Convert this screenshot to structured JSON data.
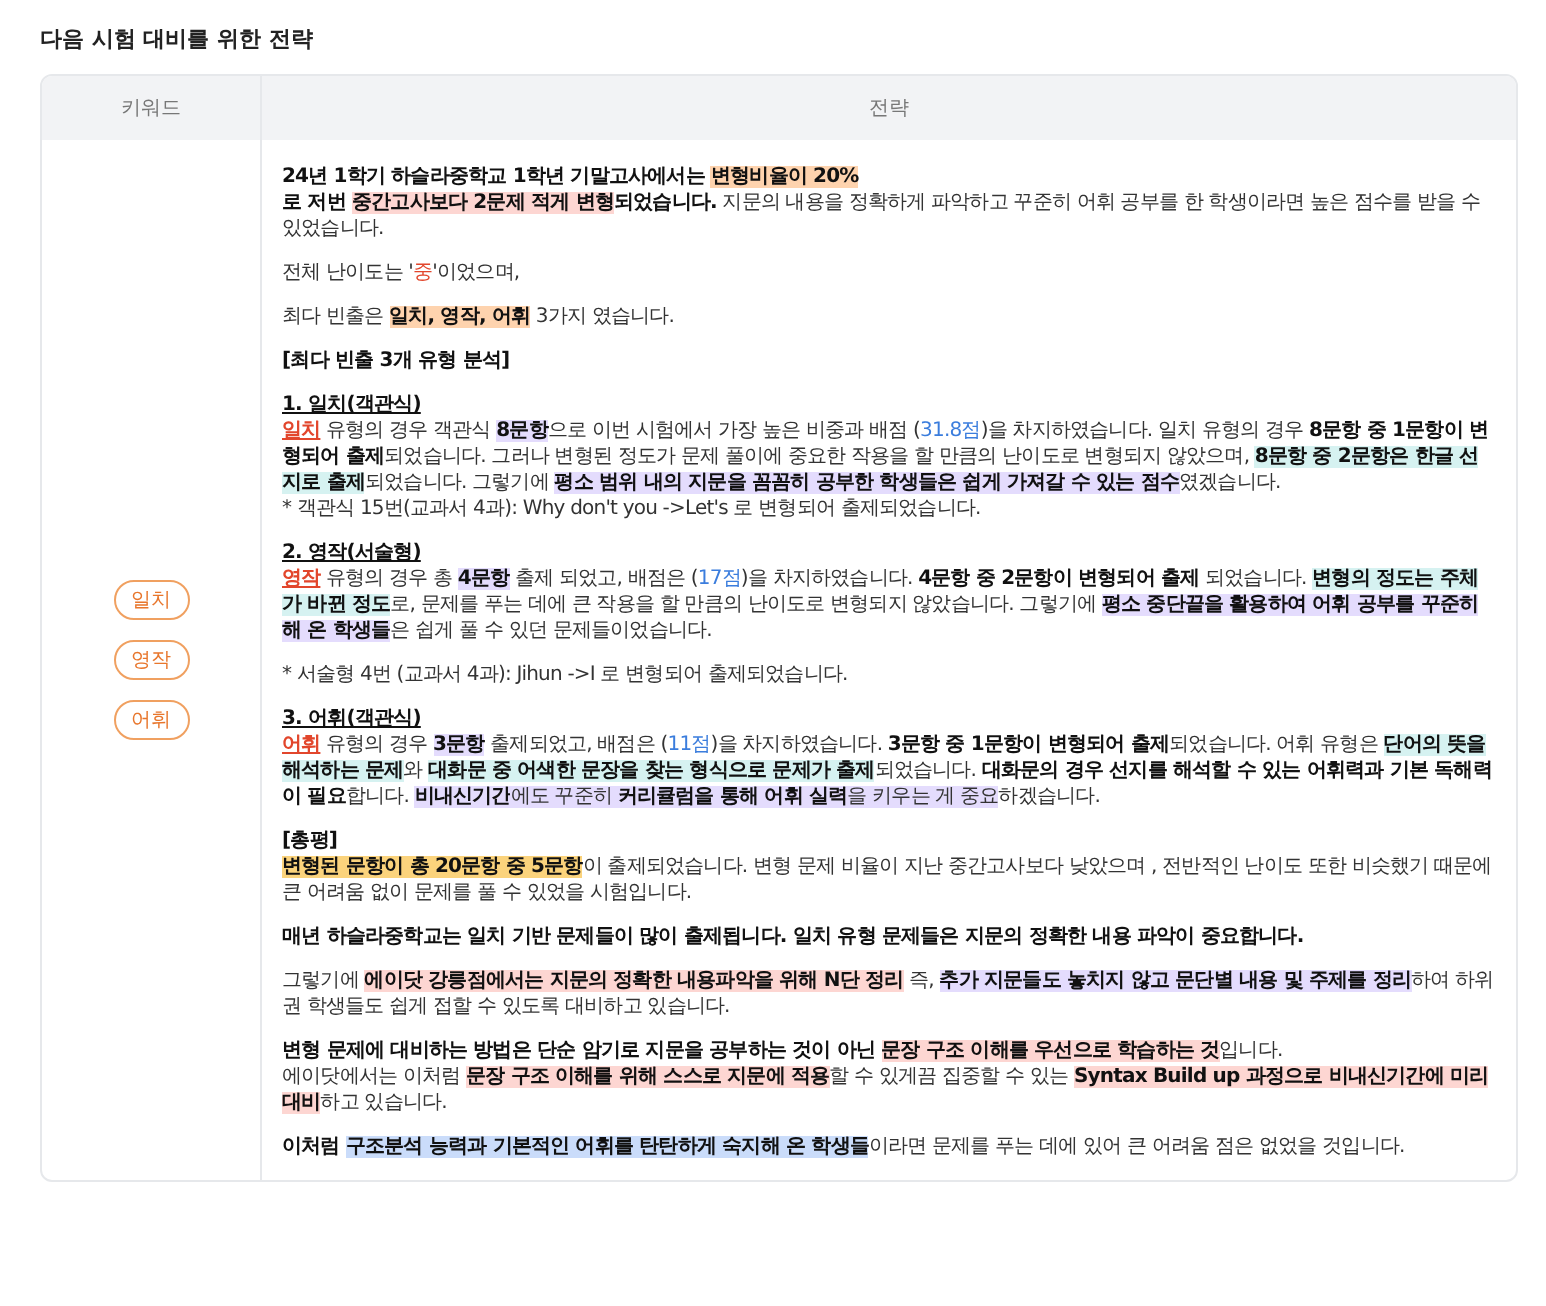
{
  "title": "다음 시험 대비를 위한 전략",
  "table": {
    "columns": [
      "키워드",
      "전략"
    ],
    "keywords": [
      "일치",
      "영작",
      "어휘"
    ],
    "blocks": [
      {
        "lines": [
          [
            {
              "text": "24년 1학기 하슬라중학교 1학년 기말고사에서는 ",
              "bold": true
            },
            {
              "text": "변형비율이 20%",
              "bold": true,
              "color": "#fed3ae"
            }
          ],
          [
            {
              "text": "로 저번 ",
              "bold": true
            },
            {
              "text": "중간고사보다 2문제 적게 변형",
              "bold": true,
              "color": "#fdd6d2"
            },
            {
              "text": "되었습니다.",
              "bold": true
            },
            {
              "text": " 지문의 내용을 정확하게 파악하고 꾸준히 어휘 공부를 한 학생이라면 높은 점수를 받을 수 있었습니다.",
              "bold": false
            }
          ]
        ]
      },
      {
        "lines": [
          [
            {
              "text": "전체 난이도는 '",
              "bold": false
            },
            {
              "text": "중",
              "bold": false,
              "kind": "accent"
            },
            {
              "text": "'이었으며,",
              "bold": false
            }
          ]
        ]
      },
      {
        "lines": [
          [
            {
              "text": "최다 빈출은 ",
              "bold": false
            },
            {
              "text": "일치, 영작, 어휘",
              "bold": true,
              "color": "#fed3ae"
            },
            {
              "text": " 3가지 였습니다.",
              "bold": false
            }
          ]
        ]
      },
      {
        "lines": [
          [
            {
              "text": "[최다 빈출 3개 유형 분석]",
              "bold": true
            }
          ]
        ]
      },
      {
        "lines": [
          [
            {
              "text": "1. 일치(객관식)",
              "bold": true,
              "underline": true
            }
          ],
          [
            {
              "text": "일치",
              "bold": true,
              "kind": "accent",
              "underline": true
            },
            {
              "text": " 유형의 경우 객관식 ",
              "bold": false
            },
            {
              "text": "8문항",
              "bold": true,
              "color": "#e4dcfd"
            },
            {
              "text": "으로 이번 시험에서 가장 높은 비중과 배점 (",
              "bold": false
            },
            {
              "text": "31.8점",
              "bold": false,
              "kind": "score"
            },
            {
              "text": ")을 차지하였습니다. 일치 유형의 경우 ",
              "bold": false
            },
            {
              "text": "8문항 중 1문항이 변형되어 출제",
              "bold": true
            },
            {
              "text": "되었습니다. 그러나 변형된 정도가 문제 풀이에 중요한 작용을 할 만큼의 난이도로 변형되지 않았으며, ",
              "bold": false
            },
            {
              "text": "8문항 중 2문항은 한글 선지로 출제",
              "bold": true,
              "color": "#d6f2f1"
            },
            {
              "text": "되었습니다. 그렇기에 ",
              "bold": false
            },
            {
              "text": "평소 범위 내의 지문을 꼼꼼히 공부한 학생들은 쉽게 가져갈 수 있는 점수",
              "bold": true,
              "color": "#e4dcfd"
            },
            {
              "text": "였겠습니다.",
              "bold": false
            }
          ],
          [
            {
              "text": "* 객관식 15번(교과서 4과): Why don't you ->Let's 로 변형되어 출제되었습니다.",
              "bold": false
            }
          ]
        ]
      },
      {
        "lines": [
          [
            {
              "text": "2. 영작(서술형)",
              "bold": true,
              "underline": true
            }
          ],
          [
            {
              "text": "영작",
              "bold": true,
              "kind": "accent",
              "underline": true
            },
            {
              "text": " 유형의 경우 총 ",
              "bold": false
            },
            {
              "text": "4문항",
              "bold": true,
              "color": "#e4dcfd"
            },
            {
              "text": " 출제 되었고, 배점은 (",
              "bold": false
            },
            {
              "text": "17점",
              "bold": false,
              "kind": "score"
            },
            {
              "text": ")을 차지하였습니다. ",
              "bold": false
            },
            {
              "text": "4문항 중 2문항이 변형되어 출제",
              "bold": true
            },
            {
              "text": " 되었습니다. ",
              "bold": false
            },
            {
              "text": "변형의 정도는 주체가 바뀐 정도",
              "bold": true,
              "color": "#d6f2f1"
            },
            {
              "text": "로, 문제를 푸는 데에 큰 작용을 할 만큼의 난이도로 변형되지 않았습니다. 그렇기에 ",
              "bold": false
            },
            {
              "text": "평소 중단끝을 활용하여 어휘 공부를 꾸준히 해 온 학생들",
              "bold": true,
              "color": "#e4dcfd"
            },
            {
              "text": "은 쉽게 풀 수 있던 문제들이었습니다.",
              "bold": false
            }
          ]
        ]
      },
      {
        "lines": [
          [
            {
              "text": "* 서술형 4번 (교과서 4과): Jihun ->I 로 변형되어 출제되었습니다.",
              "bold": false
            }
          ]
        ]
      },
      {
        "lines": [
          [
            {
              "text": "3. 어휘(객관식)",
              "bold": true,
              "underline": true
            }
          ],
          [
            {
              "text": "어휘",
              "bold": true,
              "kind": "accent",
              "underline": true
            },
            {
              "text": " 유형의 경우 ",
              "bold": false
            },
            {
              "text": "3문항",
              "bold": true,
              "color": "#e4dcfd"
            },
            {
              "text": " 출제되었고, 배점은 (",
              "bold": false
            },
            {
              "text": "11점",
              "bold": false,
              "kind": "score"
            },
            {
              "text": ")을 차지하였습니다. ",
              "bold": false
            },
            {
              "text": "3문항 중 1문항이 변형되어 출제",
              "bold": true
            },
            {
              "text": "되었습니다. 어휘 유형은 ",
              "bold": false
            },
            {
              "text": "단어의 뜻을 해석하는 문제",
              "bold": true,
              "color": "#d6f2f1"
            },
            {
              "text": "와 ",
              "bold": false
            },
            {
              "text": "대화문 중 어색한 문장을 찾는 형식으로 문제가 출제",
              "bold": true,
              "color": "#d6f2f1"
            },
            {
              "text": "되었습니다. ",
              "bold": false
            },
            {
              "text": "대화문의 경우 선지를 해석할 수 있는 어휘력과 기본 독해력이 필요",
              "bold": true
            },
            {
              "text": "합니다. ",
              "bold": false
            },
            {
              "text": "비내신기간",
              "bold": true,
              "color": "#e4dcfd"
            },
            {
              "text": "에도 꾸준히 ",
              "bold": false,
              "color": "#e4dcfd"
            },
            {
              "text": "커리큘럼을 통해 어휘 실력",
              "bold": true,
              "color": "#e4dcfd"
            },
            {
              "text": "을 키우는 게 중요",
              "bold": false,
              "color": "#e4dcfd"
            },
            {
              "text": "하겠습니다.",
              "bold": false
            }
          ]
        ]
      },
      {
        "lines": [
          [
            {
              "text": "[총평]",
              "bold": true
            }
          ],
          [
            {
              "text": "변형된 문항이 총 20문항 중 5문항",
              "bold": true,
              "color": "#fbd37c"
            },
            {
              "text": "이 출제되었습니다. 변형 문제 비율이 지난 중간고사보다 낮았으며 , 전반적인 난이도 또한 비슷했기 때문에 큰 어려움 없이 문제를 풀 수 있었을 시험입니다.",
              "bold": false
            }
          ]
        ]
      },
      {
        "lines": [
          [
            {
              "text": "매년 하슬라중학교는 일치 기반 문제들이 많이 출제됩니다. 일치 유형 문제들은 지문의 정확한 내용 파악이 중요합니다.",
              "bold": true
            }
          ]
        ]
      },
      {
        "lines": [
          [
            {
              "text": "그렇기에 ",
              "bold": false
            },
            {
              "text": "에이닷 강릉점에서는 지문의 정확한 내용파악을 위해 N단 정리",
              "bold": true,
              "color": "#fdd6d2"
            },
            {
              "text": " 즉, ",
              "bold": false
            },
            {
              "text": "추가 지문들도 놓치지 않고 문단별 내용 및 주제를 정리",
              "bold": true,
              "color": "#e4dcfd"
            },
            {
              "text": "하여 하위권 학생들도 쉽게 접할 수 있도록 대비하고 있습니다.",
              "bold": false
            }
          ]
        ]
      },
      {
        "lines": [
          [
            {
              "text": "변형 문제에 대비하는 방법은 단순 암기로 지문을 공부하는 것이 아닌 ",
              "bold": true
            },
            {
              "text": "문장 구조 이해를 우선으로 학습하는 것",
              "bold": true,
              "color": "#fdd6d2"
            },
            {
              "text": "입니다.",
              "bold": false
            }
          ],
          [
            {
              "text": "에이닷에서는 이처럼 ",
              "bold": false
            },
            {
              "text": "문장 구조 이해를 위해 스스로 지문에 적용",
              "bold": true,
              "color": "#fdd6d2"
            },
            {
              "text": "할 수 있게끔 집중할 수 있는 ",
              "bold": false
            },
            {
              "text": "Syntax Build up 과정으로 비내신기간에 미리 대비",
              "bold": true,
              "color": "#fdd6d2"
            },
            {
              "text": "하고 있습니다.",
              "bold": false
            }
          ]
        ]
      },
      {
        "lines": [
          [
            {
              "text": "이처럼 ",
              "bold": true
            },
            {
              "text": "구조분석 능력과 기본적인 어휘를 탄탄하게 숙지해 온 학생들",
              "bold": true,
              "color": "#cadcfa"
            },
            {
              "text": "이라면 문제를 푸는 데에 있어 큰 어려움 점은 없었을 것입니다.",
              "bold": false
            }
          ]
        ]
      }
    ]
  }
}
